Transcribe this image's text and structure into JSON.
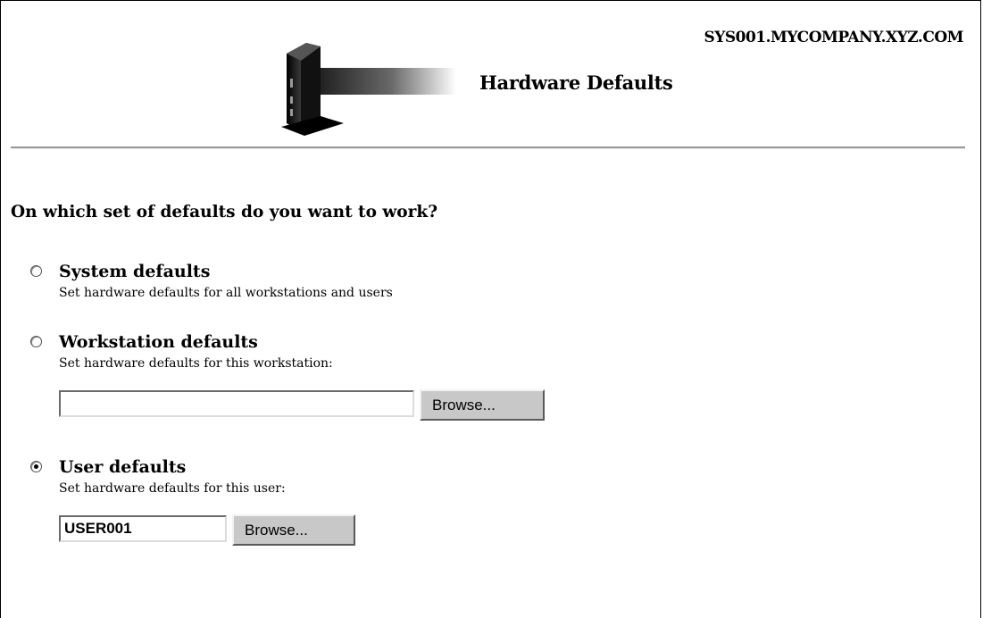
{
  "header": {
    "hostname": "SYS001.MYCOMPANY.XYZ.COM",
    "title": "Hardware Defaults",
    "banner_icon": "workstation-tower-icon"
  },
  "form": {
    "question": "On which set of defaults do you want to work?",
    "options": [
      {
        "label": "System defaults",
        "description": "Set hardware defaults for all workstations and users",
        "selected": false
      },
      {
        "label": "Workstation defaults",
        "description": "Set hardware defaults for this workstation:",
        "selected": false,
        "field_value": "",
        "browse_label": "Browse..."
      },
      {
        "label": "User defaults",
        "description": "Set hardware defaults for this user:",
        "selected": true,
        "field_value": "USER001",
        "browse_label": "Browse..."
      }
    ]
  },
  "colors": {
    "background": "#ffffff",
    "button_face": "#c8c8c8",
    "rule": "#9a9a9a"
  }
}
